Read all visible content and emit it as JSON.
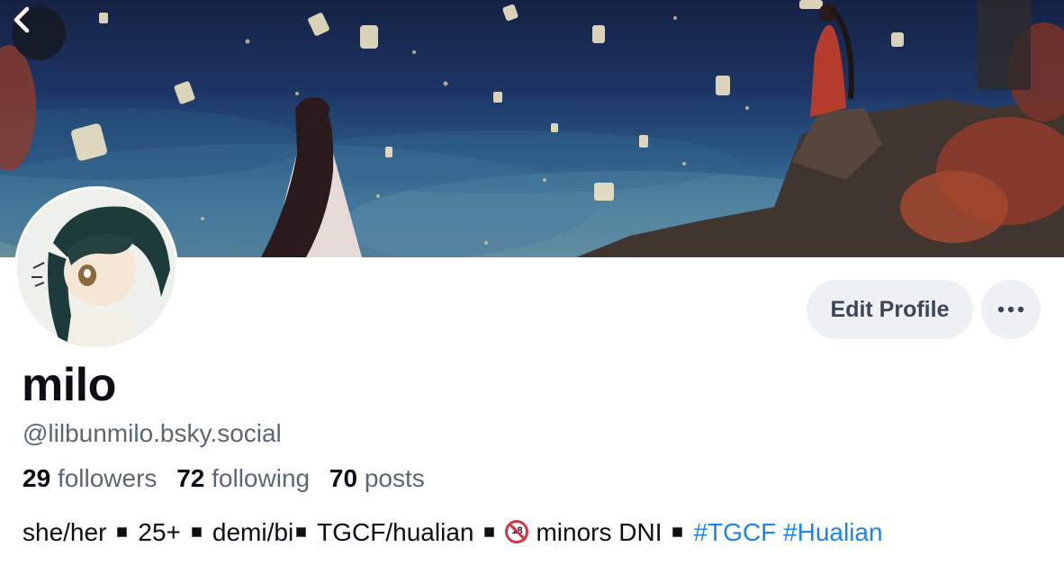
{
  "profile": {
    "display_name": "milo",
    "handle": "@lilbunmilo.bsky.social",
    "edit_button_label": "Edit Profile",
    "more_button_icon": "more-horizontal-icon",
    "back_button_icon": "chevron-left-icon"
  },
  "stats": {
    "followers_count": "29",
    "followers_label": "followers",
    "following_count": "72",
    "following_label": "following",
    "posts_count": "70",
    "posts_label": "posts"
  },
  "bio": {
    "part1": "she/her",
    "part2": "25+",
    "part3": "demi/bi",
    "part4": "TGCF/hualian",
    "no18_badge": "18",
    "part5": "minors DNI",
    "hashtag1": "#TGCF",
    "hashtag2": "#Hualian"
  },
  "colors": {
    "link": "#1d84e6",
    "muted_text": "#5b6773",
    "button_bg": "#eef1f4"
  }
}
